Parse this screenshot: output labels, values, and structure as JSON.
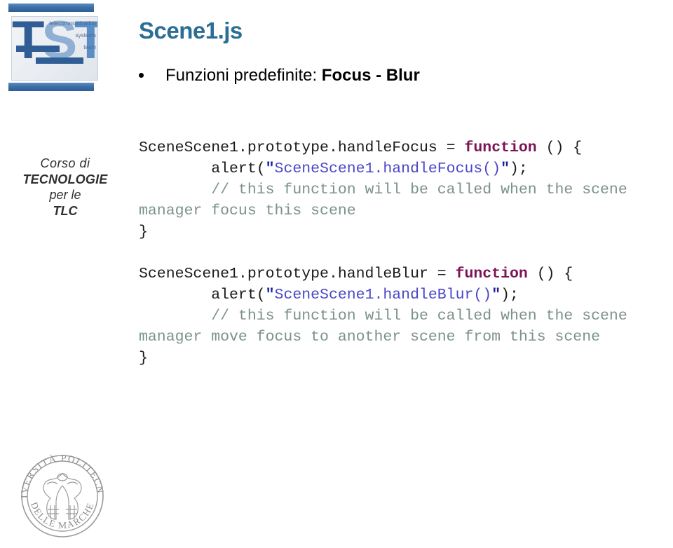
{
  "slide": {
    "title": "Scene1.js",
    "bullet": {
      "marker": "bullet-dot",
      "text_normal": "Funzioni predefinite: ",
      "text_bold": "Focus - Blur"
    }
  },
  "sidebar": {
    "logo": {
      "name": "tst-logo",
      "letters_t1": "T",
      "letters_s": "S",
      "letters_t2": "T",
      "tagline_line1": "telecommunication",
      "tagline_line2": "systems",
      "tagline_line3": "team"
    },
    "course": {
      "line1": "Corso di",
      "line2": "TECNOLOGIE",
      "line3": "per le",
      "line4": "TLC"
    },
    "seal": {
      "name": "universita-politecnica-delle-marche-seal",
      "top_text": "UNIVERSITÀ POLITECNICA",
      "bottom_text": "DELLE MARCHE"
    }
  },
  "code": {
    "block1": {
      "line1_a": "SceneScene1.prototype.handleFocus = ",
      "line1_kw": "function",
      "line1_b": " () {",
      "line2_a": "        alert(",
      "line2_q1": "\"",
      "line2_str": "SceneScene1.handleFocus()",
      "line2_q2": "\"",
      "line2_b": ");",
      "line3_comment": "        // this function will be called when the scene manager focus this scene",
      "line4": "}"
    },
    "block2": {
      "line1_a": "SceneScene1.prototype.handleBlur = ",
      "line1_kw": "function",
      "line1_b": " () {",
      "line2_a": "        alert(",
      "line2_q1": "\"",
      "line2_str": "SceneScene1.handleBlur()",
      "line2_q2": "\"",
      "line2_b": ");",
      "line3_comment": "        // this function will be called when the scene manager move focus to another scene from this scene",
      "line4": "}"
    }
  },
  "colors": {
    "title": "#2b6e95",
    "keyword": "#7b1456",
    "string": "#4a46c8",
    "quote": "#1f1f9e",
    "comment": "#7b9289",
    "logo_blue": "#2f5d94",
    "background": "#ffffff"
  }
}
